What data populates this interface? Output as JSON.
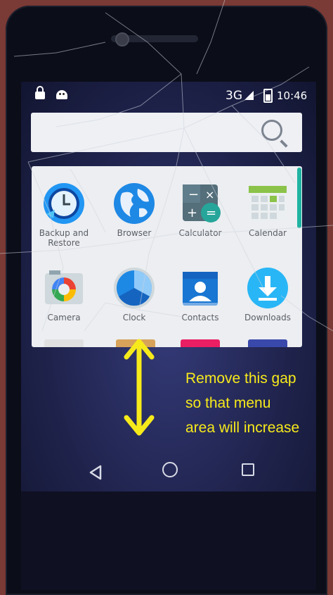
{
  "status_bar": {
    "network": "3G",
    "time": "10:46",
    "icons": [
      "lock-icon",
      "android-icon",
      "signal-icon",
      "battery-icon"
    ]
  },
  "search": {
    "icon": "search-icon"
  },
  "apps": [
    {
      "label_lines": [
        "Backup and",
        "Restore"
      ],
      "icon": "backup-restore-icon"
    },
    {
      "label_lines": [
        "Browser"
      ],
      "icon": "browser-globe-icon"
    },
    {
      "label_lines": [
        "Calculator"
      ],
      "icon": "calculator-icon"
    },
    {
      "label_lines": [
        "Calendar"
      ],
      "icon": "calendar-icon"
    },
    {
      "label_lines": [
        "Camera"
      ],
      "icon": "camera-icon"
    },
    {
      "label_lines": [
        "Clock"
      ],
      "icon": "clock-icon"
    },
    {
      "label_lines": [
        "Contacts"
      ],
      "icon": "contacts-icon"
    },
    {
      "label_lines": [
        "Downloads"
      ],
      "icon": "downloads-icon"
    }
  ],
  "navigation": {
    "icons": [
      "back-icon",
      "home-icon",
      "recents-icon"
    ]
  },
  "annotation": {
    "lines": [
      "Remove this gap",
      "so that menu",
      "area will increase"
    ],
    "color": "#f7ea1b"
  },
  "colors": {
    "accent_teal": "#20b3a2",
    "drawer_bg": "#eceef1"
  }
}
